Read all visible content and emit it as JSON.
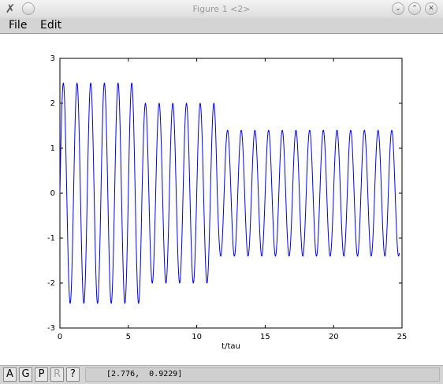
{
  "window": {
    "title": "Figure 1 <2>",
    "app_icon": "x-app-icon",
    "buttons": [
      "minimize",
      "maximize",
      "close"
    ]
  },
  "menu": {
    "items": [
      {
        "label": "File"
      },
      {
        "label": "Edit"
      }
    ]
  },
  "toolbar": {
    "buttons": [
      {
        "label": "A",
        "enabled": true
      },
      {
        "label": "G",
        "enabled": true
      },
      {
        "label": "P",
        "enabled": true
      },
      {
        "label": "R",
        "enabled": false
      },
      {
        "label": "?",
        "enabled": true
      }
    ],
    "coordinates": "[2.776,  0.9229]"
  },
  "chart_data": {
    "type": "line",
    "title": "",
    "xlabel": "t/tau",
    "ylabel": "",
    "xlim": [
      0,
      25
    ],
    "ylim": [
      -3,
      3
    ],
    "xticks": [
      0,
      5,
      10,
      15,
      20,
      25
    ],
    "yticks": [
      -3,
      -2,
      -1,
      0,
      1,
      2,
      3
    ],
    "series": [
      {
        "color": "#0000ff",
        "description_segments": [
          {
            "t_start": 0,
            "t_end": 6.0,
            "amplitude": 2.45,
            "period": 1.0
          },
          {
            "t_start": 6.0,
            "t_end": 11.5,
            "amplitude": 2.0,
            "period": 1.0
          },
          {
            "t_start": 11.5,
            "t_end": 24.8,
            "amplitude": 1.4,
            "period": 1.0
          }
        ],
        "t_end": 24.8
      }
    ]
  }
}
